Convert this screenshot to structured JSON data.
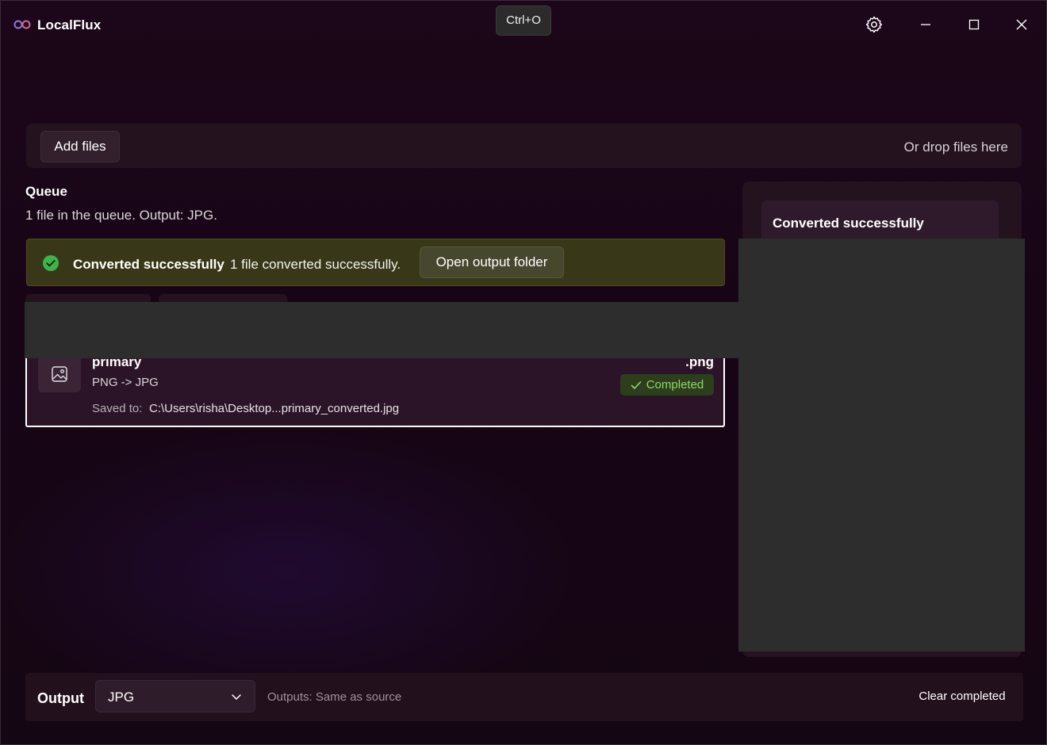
{
  "app": {
    "title": "LocalFlux",
    "tooltip": "Ctrl+O"
  },
  "dropbar": {
    "add_files_label": "Add files",
    "drop_hint": "Or drop files here"
  },
  "queue": {
    "title": "Queue",
    "subtitle": "1 file in the queue. Output: JPG."
  },
  "infobar": {
    "title": "Converted successfully",
    "message": "1 file converted successfully.",
    "action_label": "Open output folder",
    "accent": "#3bb54a"
  },
  "item": {
    "name": "primary",
    "conversion": "PNG -> JPG",
    "extension": ".png",
    "status": "Completed",
    "saved_label": "Saved to:",
    "saved_path": "C:\\Users\\risha\\Desktop...primary_converted.jpg",
    "status_color": "#8fd86b"
  },
  "side_panel": {
    "card_title": "Converted successfully"
  },
  "bottombar": {
    "output_label": "Output",
    "format": "JPG",
    "outputs_hint": "Outputs: Same as source",
    "clear_label": "Clear completed"
  },
  "icons": {
    "logo": "infinity-logo-icon",
    "settings": "gear-icon",
    "minimize": "minimize-icon",
    "maximize": "maximize-icon",
    "close": "close-icon",
    "success": "check-circle-icon",
    "file": "image-icon",
    "status": "checkmark-icon",
    "dropdown": "chevron-down-icon"
  }
}
